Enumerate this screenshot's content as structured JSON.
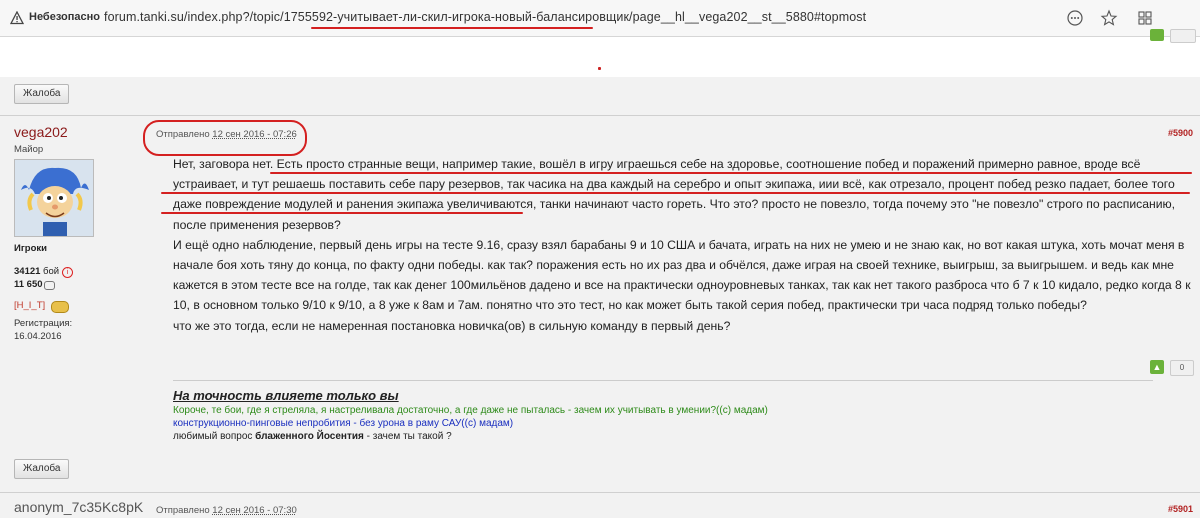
{
  "browser": {
    "security_label": "Небезопасно",
    "url": "forum.tanki.su/index.php?/topic/1755592-учитывает-ли-скил-игрока-новый-балансировщик/page__hl__vega202__st__5880#topmost",
    "icons": [
      "warning-icon",
      "ellipsis-icon",
      "star-icon",
      "extensions-icon"
    ]
  },
  "buttons": {
    "report_label": "Жалоба"
  },
  "post": {
    "author": "vega202",
    "rank": "Майор",
    "group": "Игроки",
    "battles": "34121",
    "battles_suffix": " бой",
    "messages": "11 650",
    "clan": "[H_I_T]",
    "reg_label": "Регистрация:",
    "reg_date": "16.04.2016",
    "posted_label": "Отправлено",
    "posted_date": "12 сен 2016 - 07:26",
    "number": "#5900",
    "paragraphs": [
      "Нет, заговора нет. Есть просто странные вещи, например такие, вошёл в игру играешься себе на здоровье, соотношение побед и поражений примерно равное, вроде всё устраивает, и тут решаешь поставить себе пару резервов, так часика на два каждый на серебро и опыт экипажа, иии всё, как отрезало, процент побед резко падает, более того даже повреждение модулей и ранения экипажа увеличиваются, танки начинают часто гореть. Что это? просто не повезло, тогда почему это \"не повезло\" строго по расписанию, после применения резервов?",
      "И ещё одно наблюдение, первый день игры на тесте 9.16, сразу взял барабаны 9 и 10 США и бачата, играть на них не умею и не знаю как, но вот какая штука, хоть мочат меня в начале боя хоть тяну до конца, по факту одни победы. как так? поражения есть но их раз два и обчёлся, даже играя на своей технике, выигрыш, за выигрышем. и ведь как мне кажется в этом тесте все на голде, так как денег 100мильёнов дадено и все на практически одноуровневых танках, так как нет такого разброса что б 7 к 10 кидало, редко когда 8 к 10, в основном только 9/10 к 9/10, а 8 уже к 8ам и 7ам. понятно что это тест, но как может быть такой серия побед, практически три часа подряд только победы?",
      "что же это тогда, если не намеренная постановка новичка(ов) в сильную команду в первый день?"
    ],
    "votes": "0",
    "signature": {
      "title": "На точность влияете только вы",
      "line1": "Короче, те бои, где я стреляла, я настреливала достаточно, а где даже не пыталась - зачем их учитывать в умении?((с) мадам)",
      "line2": "конструкционно-пинговые непробития - без урона в раму САУ((с) мадам)",
      "line3_pre": "любимый вопрос ",
      "line3_bold": "блаженного Йосентия",
      "line3_post": " - зачем ты такой ?"
    }
  },
  "next_post": {
    "author": "anonym_7c35Kc8pK",
    "posted_label": "Отправлено",
    "posted_date": "12 сен 2016 - 07:30",
    "number": "#5901"
  },
  "colors": {
    "annotation": "#d42020",
    "author": "#8b1a1a",
    "post_number": "#b22222"
  }
}
